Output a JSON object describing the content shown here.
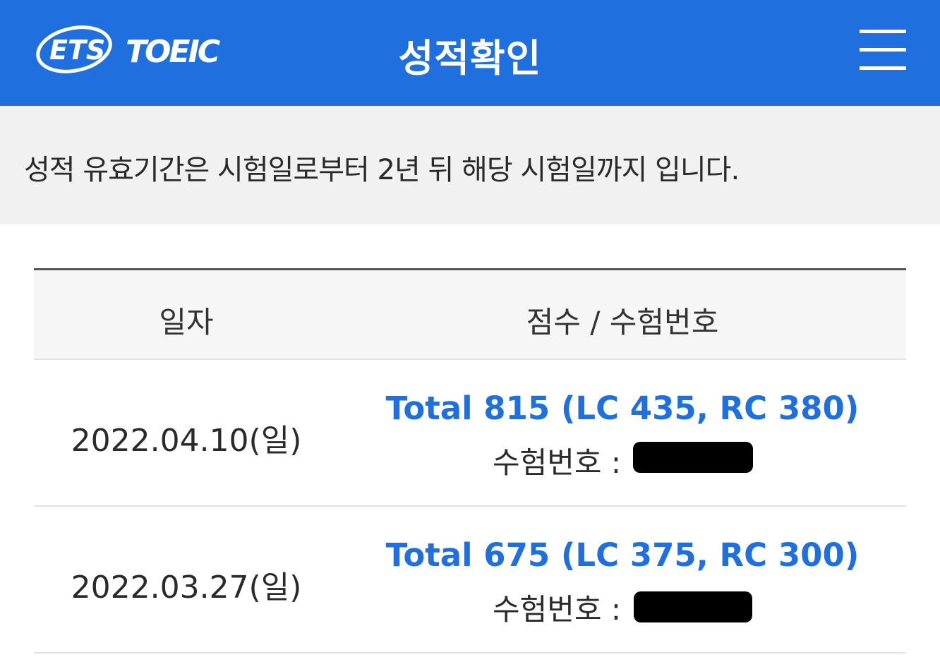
{
  "header": {
    "logo_text_left": "ETS",
    "logo_text_right": "TOEIC",
    "title": "성적확인",
    "menu_icon": "hamburger-menu-icon"
  },
  "notice": {
    "text": "성적 유효기간은 시험일로부터 2년 뒤 해당 시험일까지 입니다."
  },
  "table": {
    "headers": {
      "date": "일자",
      "score": "점수 / 수험번호"
    },
    "rows": [
      {
        "date": "2022.04.10(일)",
        "score": "Total 815 (LC 435, RC 380)",
        "exam_label": "수험번호 :"
      },
      {
        "date": "2022.03.27(일)",
        "score": "Total 675 (LC 375, RC 300)",
        "exam_label": "수험번호 :"
      }
    ]
  },
  "colors": {
    "brand_blue": "#1f6fde",
    "notice_bg": "#f1f1f1",
    "header_row_bg": "#f6f6f6"
  }
}
